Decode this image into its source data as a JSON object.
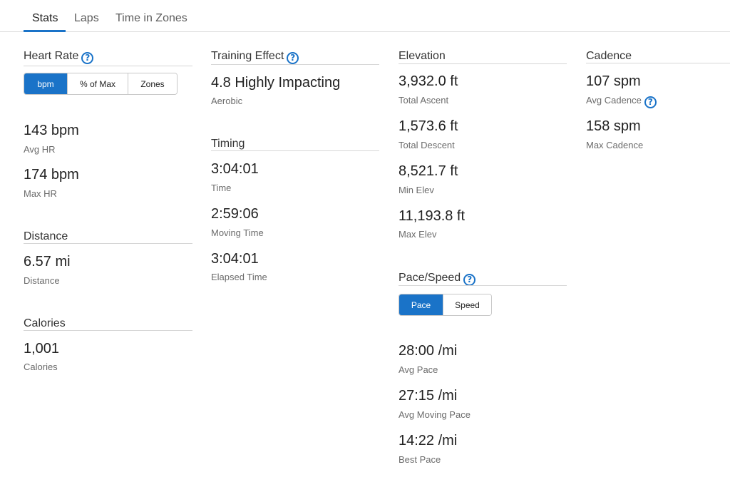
{
  "tabs": [
    "Stats",
    "Laps",
    "Time in Zones"
  ],
  "heart_rate": {
    "title": "Heart Rate",
    "toggle": [
      "bpm",
      "% of Max",
      "Zones"
    ],
    "stats": [
      {
        "value": "143 bpm",
        "label": "Avg HR"
      },
      {
        "value": "174 bpm",
        "label": "Max HR"
      }
    ]
  },
  "distance": {
    "title": "Distance",
    "stats": [
      {
        "value": "6.57 mi",
        "label": "Distance"
      }
    ]
  },
  "calories": {
    "title": "Calories",
    "stats": [
      {
        "value": "1,001",
        "label": "Calories"
      }
    ]
  },
  "training_effect": {
    "title": "Training Effect",
    "stats": [
      {
        "value": "4.8 Highly Impacting",
        "label": "Aerobic"
      }
    ]
  },
  "timing": {
    "title": "Timing",
    "stats": [
      {
        "value": "3:04:01",
        "label": "Time"
      },
      {
        "value": "2:59:06",
        "label": "Moving Time"
      },
      {
        "value": "3:04:01",
        "label": "Elapsed Time"
      }
    ]
  },
  "elevation": {
    "title": "Elevation",
    "stats": [
      {
        "value": "3,932.0 ft",
        "label": "Total Ascent"
      },
      {
        "value": "1,573.6 ft",
        "label": "Total Descent"
      },
      {
        "value": "8,521.7 ft",
        "label": "Min Elev"
      },
      {
        "value": "11,193.8 ft",
        "label": "Max Elev"
      }
    ]
  },
  "pace_speed": {
    "title": "Pace/Speed",
    "toggle": [
      "Pace",
      "Speed"
    ],
    "stats": [
      {
        "value": "28:00 /mi",
        "label": "Avg Pace"
      },
      {
        "value": "27:15 /mi",
        "label": "Avg Moving Pace"
      },
      {
        "value": "14:22 /mi",
        "label": "Best Pace"
      }
    ]
  },
  "cadence": {
    "title": "Cadence",
    "stats": [
      {
        "value": "107 spm",
        "label": "Avg Cadence"
      },
      {
        "value": "158 spm",
        "label": "Max Cadence"
      }
    ]
  },
  "icons": {
    "help": "?"
  },
  "colors": {
    "accent": "#1a73c8",
    "text": "#222222",
    "label": "#6b6b6b",
    "rule": "#d6d6d6"
  }
}
